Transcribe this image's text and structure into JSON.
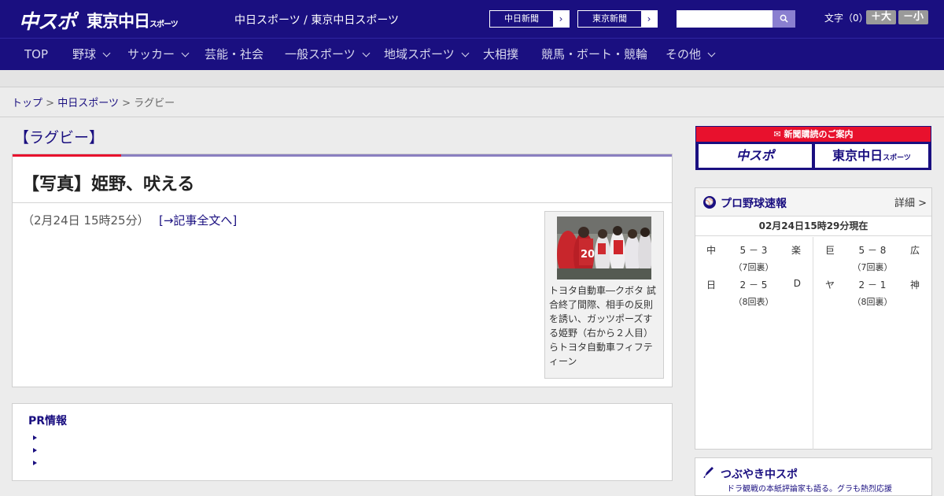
{
  "header": {
    "logo_chuspo": "中スポ",
    "logo_tokyo": "東京中日",
    "logo_tokyo_sub": "スポーツ",
    "site_title": "中日スポーツ / 東京中日スポーツ",
    "newspaper_links": [
      {
        "label": "中日新聞"
      },
      {
        "label": "東京新聞"
      }
    ],
    "search_placeholder": "",
    "font_size_label": "文字（0）",
    "font_larger": "＋大",
    "font_smaller": "－小"
  },
  "nav": {
    "items": [
      {
        "label": "TOP",
        "has_dropdown": false
      },
      {
        "label": "野球",
        "has_dropdown": true
      },
      {
        "label": "サッカー",
        "has_dropdown": true
      },
      {
        "label": "芸能・社会",
        "has_dropdown": false
      },
      {
        "label": "一般スポーツ",
        "has_dropdown": true
      },
      {
        "label": "地域スポーツ",
        "has_dropdown": true
      },
      {
        "label": "大相撲",
        "has_dropdown": false
      },
      {
        "label": "競馬・ボート・競輪",
        "has_dropdown": false
      },
      {
        "label": "その他",
        "has_dropdown": true
      }
    ]
  },
  "breadcrumb": {
    "items": [
      "トップ",
      "中日スポーツ",
      "ラグビー"
    ],
    "separator": ">"
  },
  "category_title": "【ラグビー】",
  "article": {
    "title": "【写真】姫野、吠える",
    "date": "（2月24日 15時25分）",
    "full_article_link": "[→記事全文へ]",
    "photo_caption": "トヨタ自動車―クボタ 試合終了間際、相手の反則を誘い、ガッツポーズする姫野（右から２人目）らトヨタ自動車フィフティーン",
    "photo_jersey_number": "20"
  },
  "pr": {
    "title": "PR情報",
    "items": [
      "",
      "",
      ""
    ]
  },
  "subscription": {
    "banner": "新聞購読のご案内",
    "chuspo": "中スポ",
    "tokyo": "東京中日",
    "tokyo_sub": "スポーツ"
  },
  "baseball": {
    "title": "プロ野球速報",
    "detail": "詳細 >",
    "as_of": "02月24日15時29分現在",
    "games_left": [
      {
        "team1": "中",
        "score": "5 － 3",
        "team2": "楽",
        "inning": "（7回裏）"
      },
      {
        "team1": "日",
        "score": "2 － 5",
        "team2": "D",
        "inning": "（8回表）"
      }
    ],
    "games_right": [
      {
        "team1": "巨",
        "score": "5 － 8",
        "team2": "広",
        "inning": "（7回裏）"
      },
      {
        "team1": "ヤ",
        "score": "2 － 1",
        "team2": "神",
        "inning": "（8回裏）"
      }
    ]
  },
  "tsubuyaki": {
    "title": "つぶやき中スポ",
    "subtitle": "ドラ観戦の本紙評論家も語る。グラも熱烈応援"
  },
  "colors": {
    "brand_navy": "#1a0f80",
    "accent_red": "#e8112d"
  }
}
